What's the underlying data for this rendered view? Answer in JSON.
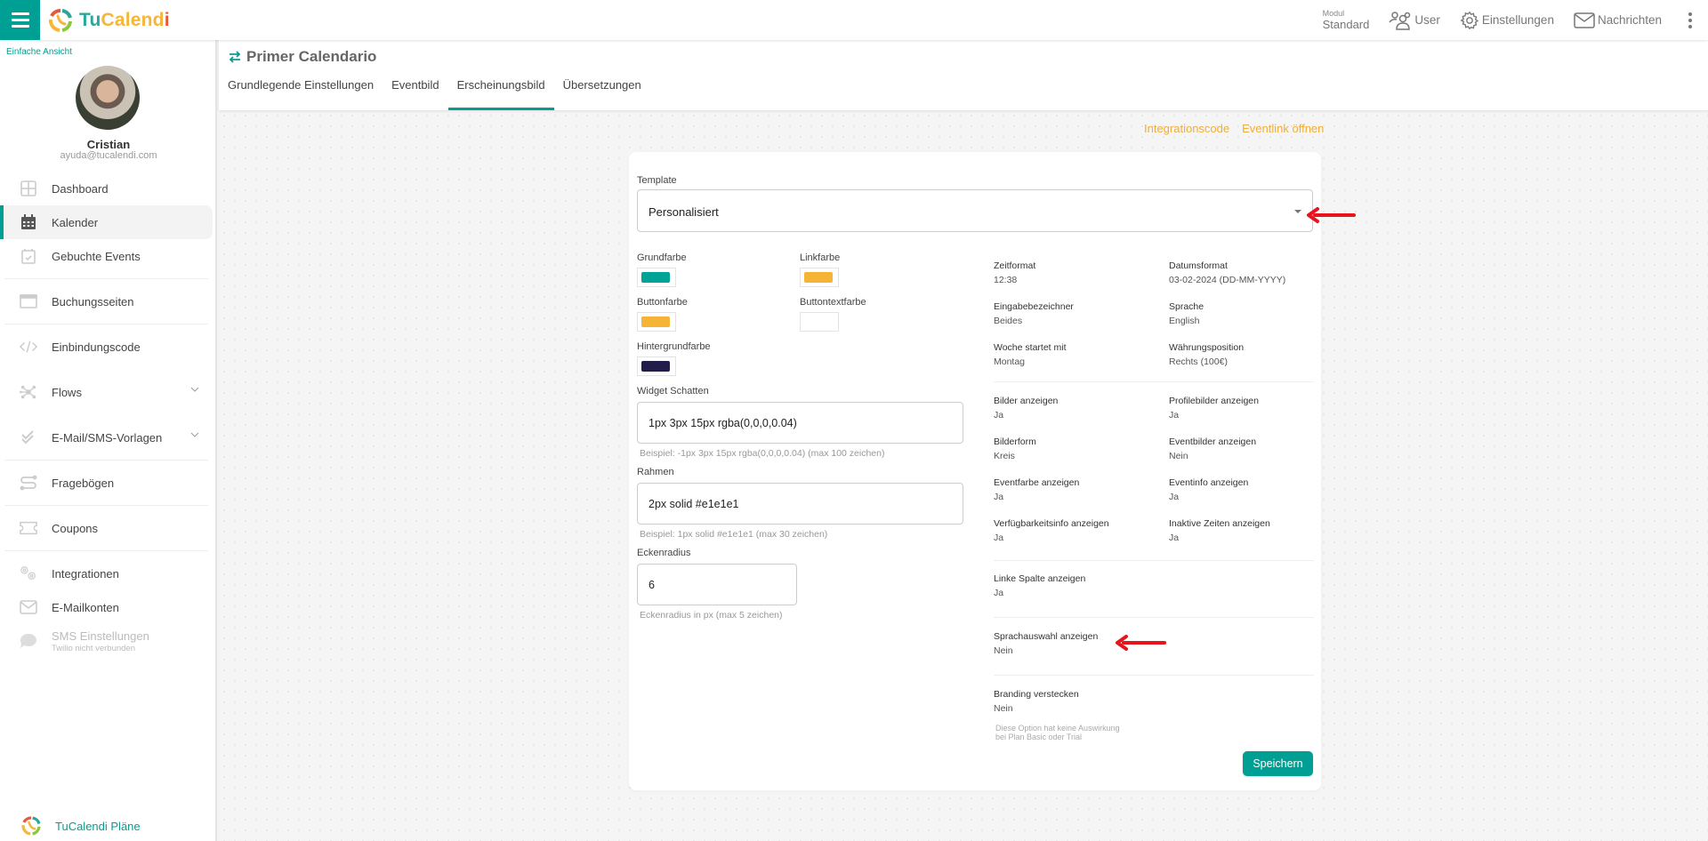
{
  "topbar": {
    "brand": {
      "part1": "Tu",
      "part2": "Calend",
      "part3": "i"
    },
    "modul_label": "Modul",
    "modul_value": "Standard",
    "user_label": "User",
    "settings_label": "Einstellungen",
    "messages_label": "Nachrichten"
  },
  "sidebar": {
    "simple_view": "Einfache Ansicht",
    "user_name": "Cristian",
    "user_email": "ayuda@tucalendi.com",
    "items": [
      {
        "label": "Dashboard",
        "icon": "dashboard-icon"
      },
      {
        "label": "Kalender",
        "icon": "calendar-icon",
        "active": true
      },
      {
        "label": "Gebuchte Events",
        "icon": "calendar-check-icon"
      },
      {
        "label": "Buchungsseiten",
        "icon": "browser-window-icon"
      },
      {
        "label": "Einbindungscode",
        "icon": "code-icon"
      },
      {
        "label": "Flows",
        "icon": "flows-icon",
        "expandable": true
      },
      {
        "label": "E-Mail/SMS-Vorlagen",
        "icon": "double-check-icon",
        "expandable": true
      },
      {
        "label": "Fragebögen",
        "icon": "questionnaire-icon"
      },
      {
        "label": "Coupons",
        "icon": "coupon-icon"
      },
      {
        "label": "Integrationen",
        "icon": "gears-icon"
      },
      {
        "label": "E-Mailkonten",
        "icon": "mail-icon"
      },
      {
        "label": "SMS Einstellungen",
        "sublabel": "Twilio nicht verbunden",
        "icon": "sms-icon",
        "disabled": true
      }
    ],
    "plans_label": "TuCalendi Pläne"
  },
  "header": {
    "title": "Primer Calendario",
    "tabs": [
      {
        "label": "Grundlegende Einstellungen"
      },
      {
        "label": "Eventbild"
      },
      {
        "label": "Erscheinungsbild",
        "active": true
      },
      {
        "label": "Übersetzungen"
      }
    ]
  },
  "links": {
    "integration_code": "Integrationscode",
    "open_event_link": "Eventlink öffnen"
  },
  "form": {
    "template_label": "Template",
    "template_value": "Personalisiert",
    "colors": {
      "base_label": "Grundfarbe",
      "base_color": "#00a396",
      "link_label": "Linkfarbe",
      "link_color": "#f6b437",
      "button_label": "Buttonfarbe",
      "button_color": "#f6b437",
      "button_text_label": "Buttontextfarbe",
      "button_text_color": "#ffffff",
      "background_label": "Hintergrundfarbe",
      "background_color": "#221c4b"
    },
    "shadow_label": "Widget Schatten",
    "shadow_value": "1px 3px 15px rgba(0,0,0,0.04)",
    "shadow_hint": "Beispiel: -1px 3px 15px rgba(0,0,0,0.04) (max 100 zeichen)",
    "border_label": "Rahmen",
    "border_value": "2px solid #e1e1e1",
    "border_hint": "Beispiel: 1px solid #e1e1e1 (max 30 zeichen)",
    "radius_label": "Eckenradius",
    "radius_value": "6",
    "radius_hint": "Eckenradius in px (max 5 zeichen)",
    "options": {
      "time_format": {
        "k": "Zeitformat",
        "v": "12:38"
      },
      "date_format": {
        "k": "Datumsformat",
        "v": "03-02-2024 (DD-MM-YYYY)"
      },
      "input_labels": {
        "k": "Eingabebezeichner",
        "v": "Beides"
      },
      "language": {
        "k": "Sprache",
        "v": "English"
      },
      "week_start": {
        "k": "Woche startet mit",
        "v": "Montag"
      },
      "currency_pos": {
        "k": "Währungsposition",
        "v": "Rechts (100€)"
      },
      "show_images": {
        "k": "Bilder anzeigen",
        "v": "Ja"
      },
      "show_profile_images": {
        "k": "Profilebilder anzeigen",
        "v": "Ja"
      },
      "image_shape": {
        "k": "Bilderform",
        "v": "Kreis"
      },
      "show_event_images": {
        "k": "Eventbilder anzeigen",
        "v": "Nein"
      },
      "show_event_color": {
        "k": "Eventfarbe anzeigen",
        "v": "Ja"
      },
      "show_event_info": {
        "k": "Eventinfo anzeigen",
        "v": "Ja"
      },
      "show_availability": {
        "k": "Verfügbarkeitsinfo anzeigen",
        "v": "Ja"
      },
      "show_inactive_times": {
        "k": "Inaktive Zeiten anzeigen",
        "v": "Ja"
      },
      "show_left_column": {
        "k": "Linke Spalte anzeigen",
        "v": "Ja"
      },
      "show_language_select": {
        "k": "Sprachauswahl anzeigen",
        "v": "Nein"
      },
      "hide_branding": {
        "k": "Branding verstecken",
        "v": "Nein"
      }
    },
    "branding_note_1": "Diese Option hat keine Auswirkung",
    "branding_note_2": "bei Plan Basic oder Trial",
    "save_label": "Speichern"
  },
  "annotations": {
    "arrow_color": "#e8141b"
  }
}
